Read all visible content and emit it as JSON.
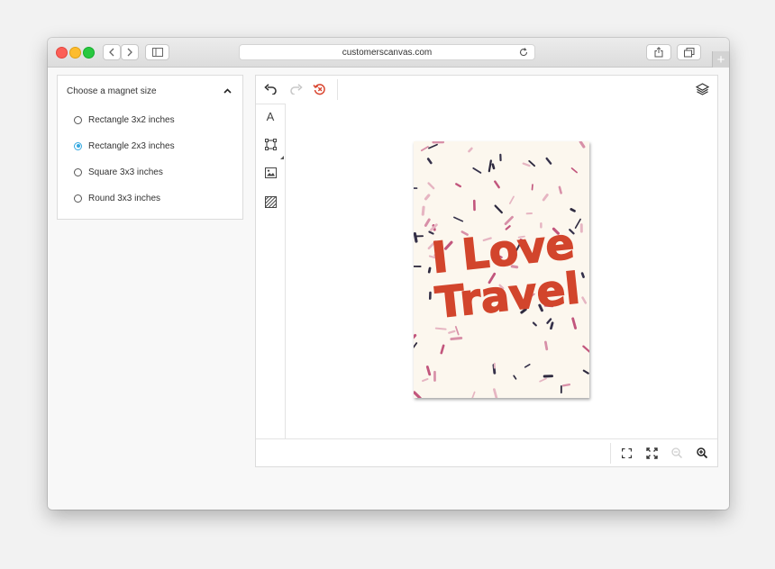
{
  "browser": {
    "url": "customerscanvas.com",
    "newtab_glyph": "+",
    "icons": [
      "back-icon",
      "forward-icon",
      "sidebar-icon",
      "reload-icon",
      "share-icon",
      "tabs-icon"
    ]
  },
  "panel": {
    "title": "Choose a magnet size",
    "options": [
      {
        "label": "Rectangle 3x2 inches",
        "selected": false
      },
      {
        "label": "Rectangle 2x3 inches",
        "selected": true
      },
      {
        "label": "Square 3x3 inches",
        "selected": false
      },
      {
        "label": "Round 3x3 inches",
        "selected": false
      }
    ]
  },
  "editor": {
    "text_tool_glyph": "A",
    "accent_color": "#33a8e0",
    "revert_color": "#d9452f"
  },
  "magnet": {
    "line1": "I Love",
    "line2": "Travel",
    "text_color": "#d2452c",
    "background_color": "#fcf7ee"
  }
}
